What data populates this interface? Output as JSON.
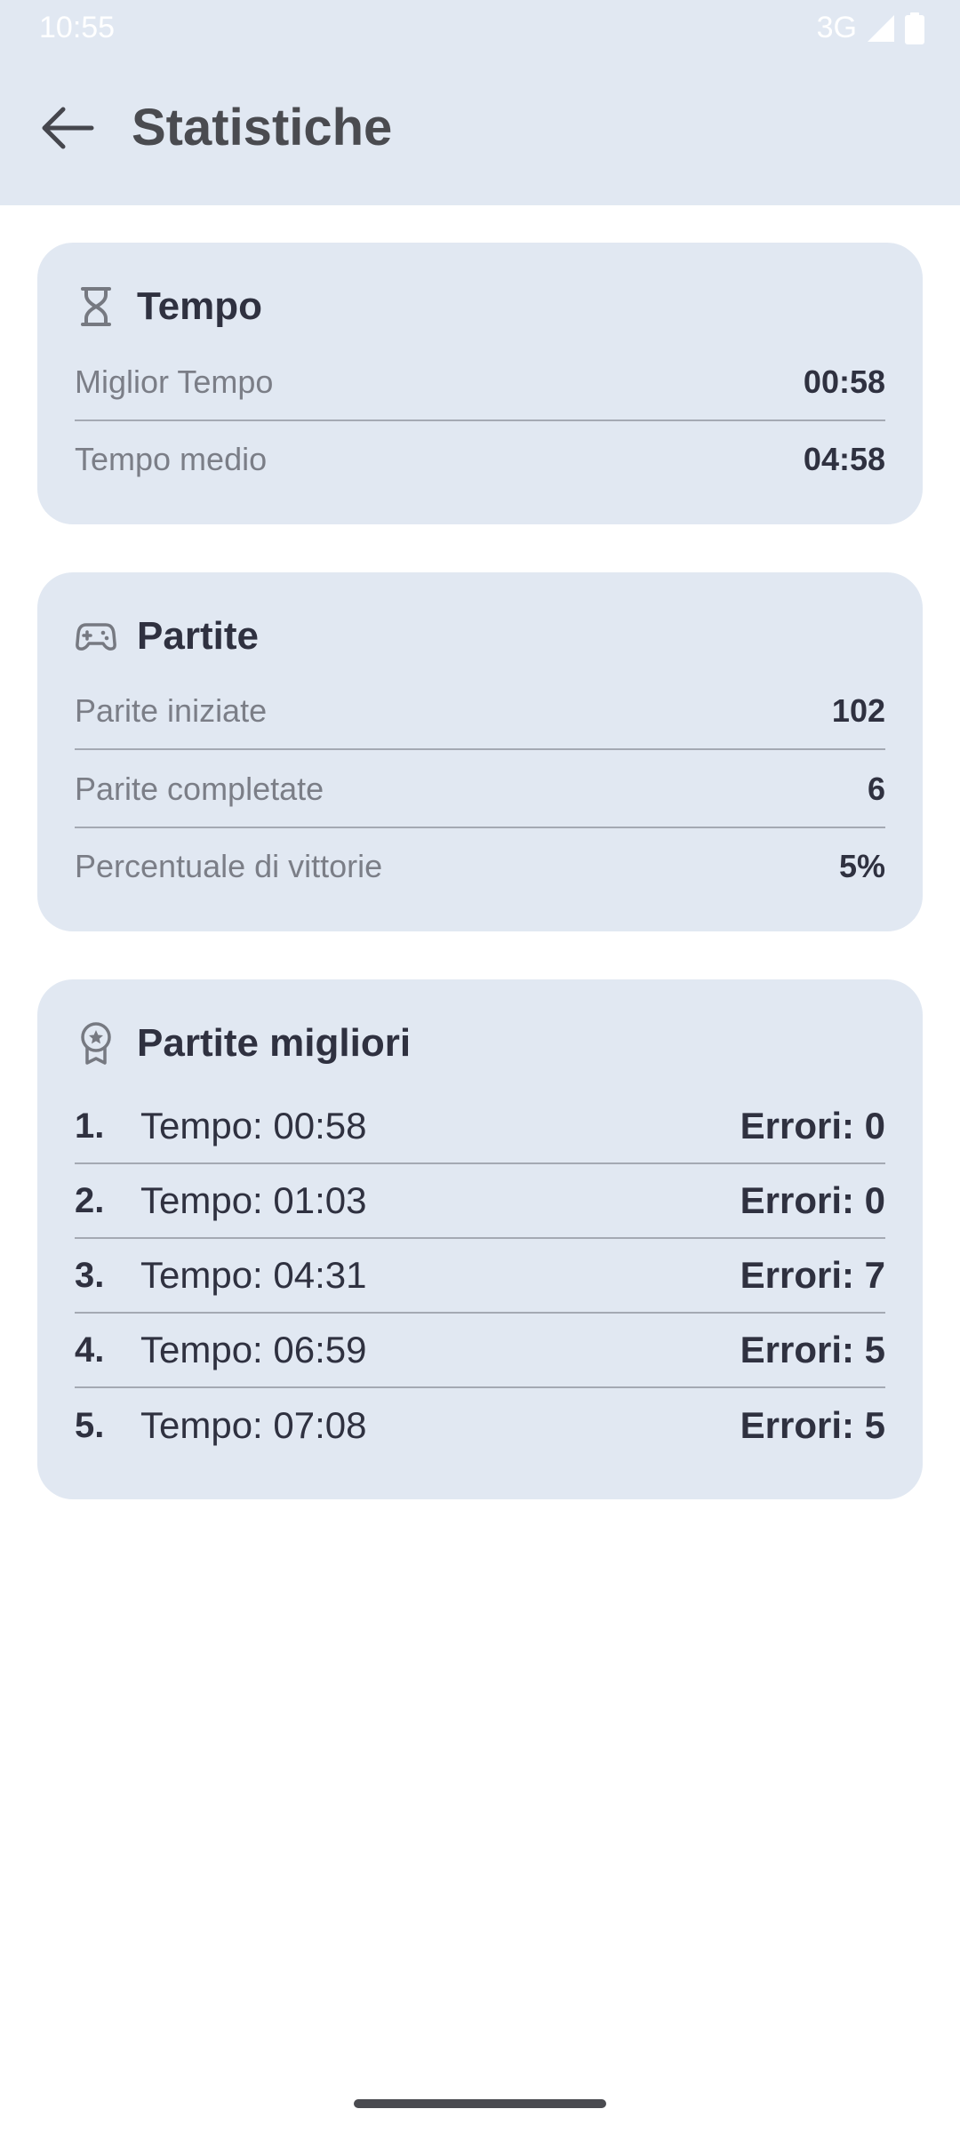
{
  "status_bar": {
    "time": "10:55",
    "network": "3G"
  },
  "header": {
    "title": "Statistiche",
    "back_icon": "arrow-left-icon"
  },
  "time_card": {
    "title": "Tempo",
    "icon": "hourglass-icon",
    "rows": [
      {
        "label": "Miglior Tempo",
        "value": "00:58"
      },
      {
        "label": "Tempo medio",
        "value": "04:58"
      }
    ]
  },
  "games_card": {
    "title": "Partite",
    "icon": "gamepad-icon",
    "rows": [
      {
        "label": "Parite iniziate",
        "value": "102"
      },
      {
        "label": "Parite completate",
        "value": "6"
      },
      {
        "label": "Percentuale di vittorie",
        "value": "5%"
      }
    ]
  },
  "best_card": {
    "title": "Partite migliori",
    "icon": "award-icon",
    "rows": [
      {
        "rank": "1.",
        "time": "Tempo: 00:58",
        "errors": "Errori: 0"
      },
      {
        "rank": "2.",
        "time": "Tempo: 01:03",
        "errors": "Errori: 0"
      },
      {
        "rank": "3.",
        "time": "Tempo: 04:31",
        "errors": "Errori: 7"
      },
      {
        "rank": "4.",
        "time": "Tempo: 06:59",
        "errors": "Errori: 5"
      },
      {
        "rank": "5.",
        "time": "Tempo: 07:08",
        "errors": "Errori: 5"
      }
    ]
  },
  "colors": {
    "surface": "#e1e8f2",
    "text_primary": "#2f3140",
    "text_secondary": "#7b7e87"
  }
}
